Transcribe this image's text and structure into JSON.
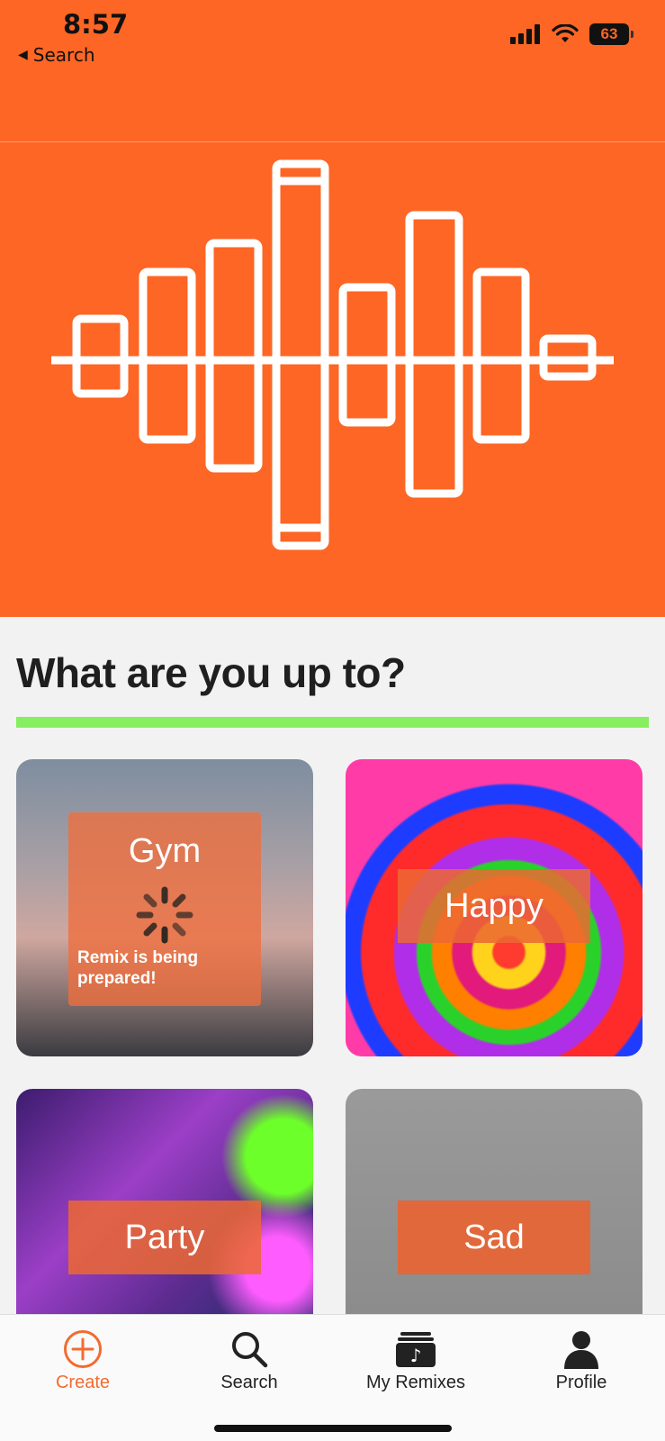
{
  "status_bar": {
    "time": "8:57",
    "back_label": "Search",
    "battery": "63",
    "icons": [
      "signal-icon",
      "wifi-icon",
      "battery-icon"
    ]
  },
  "hero": {
    "icon": "sound-wave-icon",
    "background": "#fd6624"
  },
  "section": {
    "title": "What are you up to?",
    "accent_color": "#86ef5f"
  },
  "moods": [
    {
      "label": "Gym",
      "status": "Remix is being prepared!"
    },
    {
      "label": "Happy"
    },
    {
      "label": "Party"
    },
    {
      "label": "Sad"
    }
  ],
  "tabbar": {
    "items": [
      {
        "label": "Create",
        "icon": "plus-circle-icon",
        "active": true
      },
      {
        "label": "Search",
        "icon": "search-icon",
        "active": false
      },
      {
        "label": "My Remixes",
        "icon": "music-folder-icon",
        "active": false
      },
      {
        "label": "Profile",
        "icon": "person-icon",
        "active": false
      }
    ]
  },
  "colors": {
    "brand": "#fd6624",
    "active_tab": "#f26b32"
  }
}
